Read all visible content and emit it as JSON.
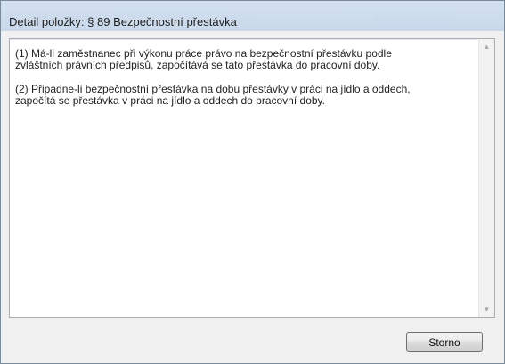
{
  "dialog": {
    "title": "Detail položky: § 89 Bezpečnostní přestávka",
    "paragraphs": [
      "(1) Má-li zaměstnanec při výkonu práce právo na bezpečnostní přestávku podle\nzvláštních právních předpisů, započítává se tato přestávka do pracovní doby.",
      "(2) Připadne-li bezpečnostní přestávka na dobu přestávky v práci na jídlo a oddech,\nzapočítá se přestávka v práci na jídlo a oddech do pracovní doby."
    ],
    "cancel_label": "Storno"
  },
  "icons": {
    "scroll_up": "scroll-up-arrow",
    "scroll_down": "scroll-down-arrow"
  }
}
